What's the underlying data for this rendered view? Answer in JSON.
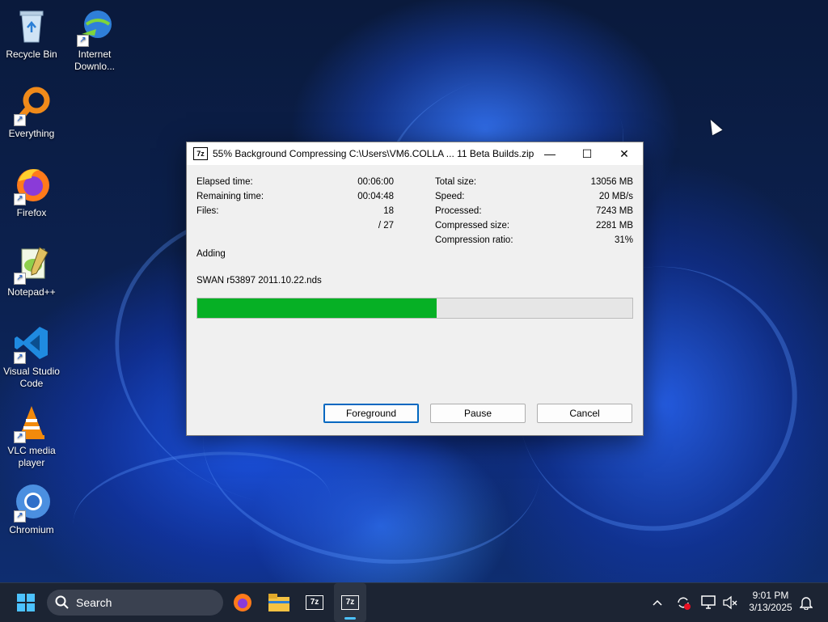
{
  "desktop": {
    "icons": [
      {
        "label": "Recycle Bin",
        "icon": "recycle-bin-icon"
      },
      {
        "label": "Internet Downlo...",
        "icon": "internet-download-manager-icon"
      },
      {
        "label": "Everything",
        "icon": "everything-search-icon"
      },
      {
        "label": "Firefox",
        "icon": "firefox-icon"
      },
      {
        "label": "Notepad++",
        "icon": "notepad-plus-plus-icon"
      },
      {
        "label": "Visual Studio Code",
        "icon": "vscode-icon"
      },
      {
        "label": "VLC media player",
        "icon": "vlc-icon"
      },
      {
        "label": "Chromium",
        "icon": "chromium-icon"
      }
    ]
  },
  "dialog": {
    "app_icon_text": "7z",
    "title": "55% Background Compressing C:\\Users\\VM6.COLLA ... 11 Beta Builds.zip",
    "controls": {
      "minimize": "—",
      "maximize": "☐",
      "close": "✕"
    },
    "left_stats": [
      {
        "label": "Elapsed time:",
        "value": "00:06:00"
      },
      {
        "label": "Remaining time:",
        "value": "00:04:48"
      },
      {
        "label": "Files:",
        "value": "18"
      },
      {
        "label": "",
        "value": "/ 27"
      }
    ],
    "right_stats": [
      {
        "label": "Total size:",
        "value": "13056 MB"
      },
      {
        "label": "Speed:",
        "value": "20 MB/s"
      },
      {
        "label": "Processed:",
        "value": "7243 MB"
      },
      {
        "label": "Compressed size:",
        "value": "2281 MB"
      },
      {
        "label": "Compression ratio:",
        "value": "31%"
      }
    ],
    "status": "Adding",
    "current_file": "SWAN r53897 2011.10.22.nds",
    "progress_fraction": 0.55,
    "progress_color": "#06b025",
    "buttons": {
      "foreground": "Foreground",
      "pause": "Pause",
      "cancel": "Cancel"
    }
  },
  "taskbar": {
    "search_placeholder": "Search",
    "pinned": [
      {
        "icon": "firefox-icon"
      },
      {
        "icon": "file-explorer-icon"
      },
      {
        "icon": "7zip-icon",
        "text": "7z"
      },
      {
        "icon": "7zip-icon",
        "text": "7z",
        "active": true
      }
    ],
    "clock": {
      "time": "9:01 PM",
      "date": "3/13/2025"
    }
  }
}
